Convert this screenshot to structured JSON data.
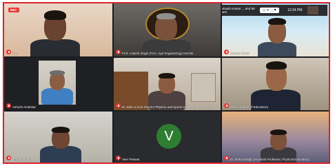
{
  "recording_badge": "REC",
  "top_bar": {
    "notification": "Avinash Kumar ... and 99 more",
    "time": "12:34 PM"
  },
  "participants": [
    {
      "name": "You"
    },
    {
      "name": "Prof. Lokesh Singh (PVC, Agri Engineering) Hon'ble"
    },
    {
      "name": "Gaurav Singh"
    },
    {
      "name": "Ashesh Ambekar"
    },
    {
      "name": "Dr Jatin H Soni Director PhyEdu and Sports Gujarat University Gujar"
    },
    {
      "name": "Dean (School of Education)"
    },
    {
      "name": "sarfesh singh"
    },
    {
      "name": "Veer Panwar",
      "avatar_letter": "V",
      "avatar_color": "#2e7d32"
    },
    {
      "name": "Dr. Rahul Singh (Assistant Professor, Physical Education)"
    }
  ]
}
